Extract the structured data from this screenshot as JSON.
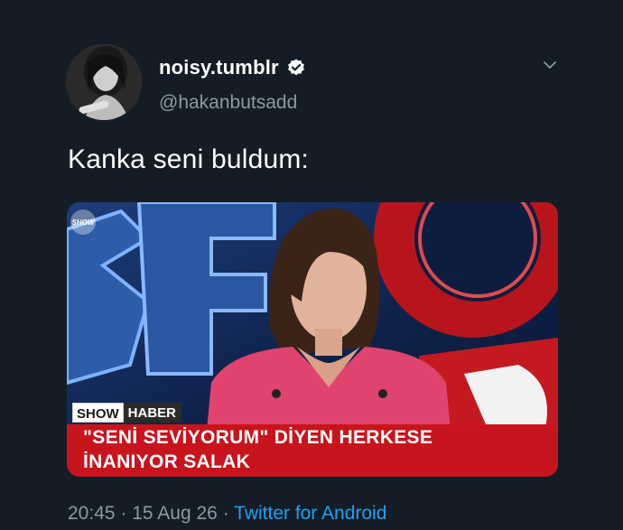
{
  "tweet": {
    "display_name": "noisy.tumblr",
    "verified": true,
    "handle": "@hakanbutsadd",
    "text": "Kanka seni buldum:",
    "time": "20:45",
    "separator": "·",
    "date": "15 Aug 26",
    "source": "Twitter for Android"
  },
  "media": {
    "channel_logo": "SHOW",
    "tag_show": "SHOW",
    "tag_haber": "HABER",
    "headline_line1": "\"SENİ SEVİYORUM\" DİYEN HERKESE",
    "headline_line2": "İNANIYOR SALAK"
  },
  "icons": {
    "verified": "verified-badge-icon",
    "menu": "chevron-down-icon"
  },
  "colors": {
    "background": "#141d26",
    "secondary_text": "#8899a6",
    "link": "#1da1f2",
    "headline_bar": "#c8141c"
  }
}
